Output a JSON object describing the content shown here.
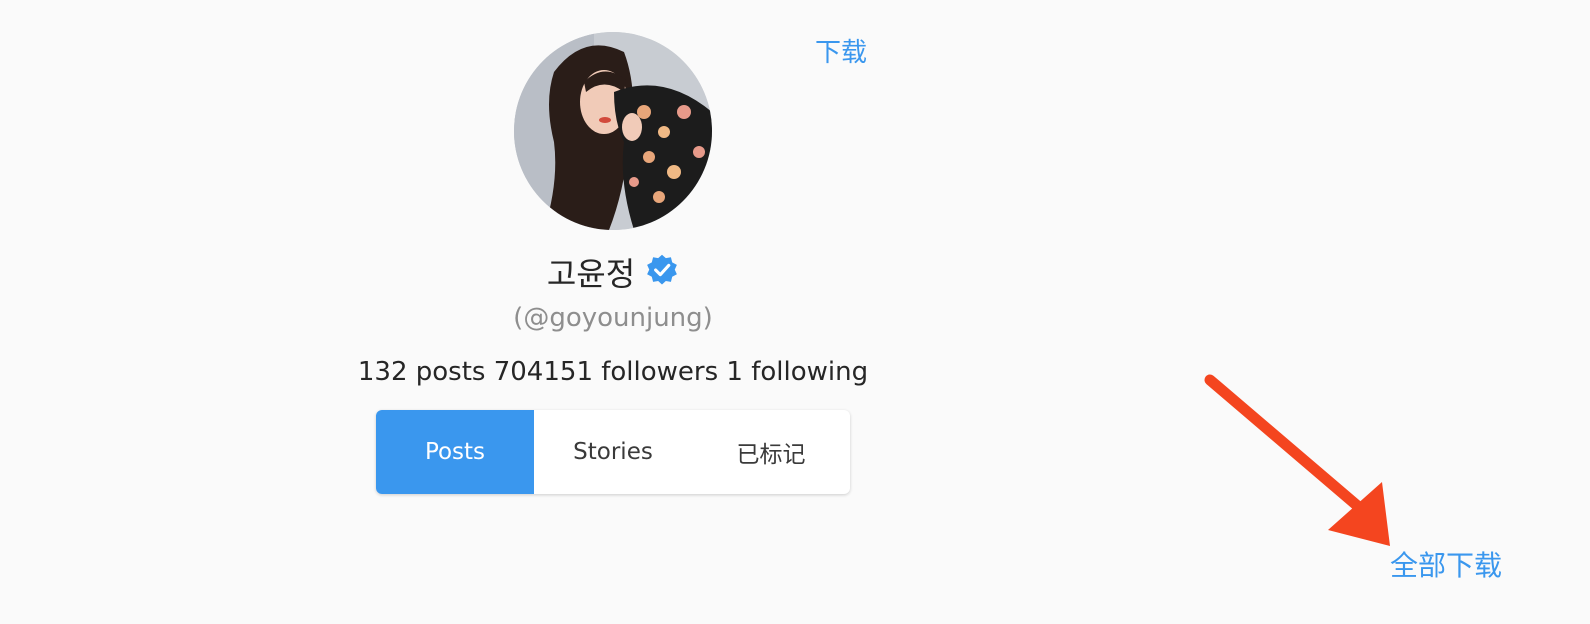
{
  "profile": {
    "display_name": "고윤정",
    "handle": "(@goyounjung)",
    "verified": true,
    "stats_text": "132 posts 704151 followers 1 following",
    "avatar_icon": "profile-photo"
  },
  "actions": {
    "download_label": "下载",
    "download_all_label": "全部下载"
  },
  "tabs": [
    {
      "label": "Posts",
      "active": true
    },
    {
      "label": "Stories",
      "active": false
    },
    {
      "label": "已标记",
      "active": false
    }
  ],
  "colors": {
    "accent": "#3a97ee",
    "annotation_arrow": "#f4451f",
    "background": "#fafafa"
  }
}
